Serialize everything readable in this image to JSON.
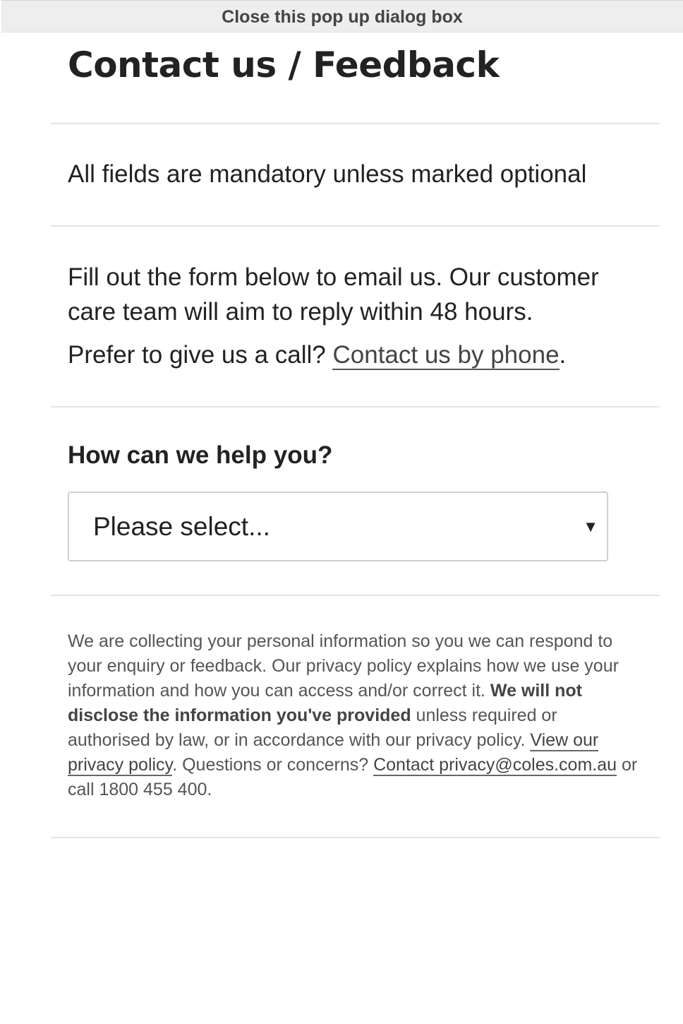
{
  "dialog": {
    "close_label": "Close this pop up dialog box",
    "title": "Contact us / Feedback"
  },
  "form": {
    "mandatory_note": "All fields are mandatory unless marked optional",
    "intro": "Fill out the form below to email us. Our customer care team will aim to reply within 48 hours.",
    "phone_prompt": "Prefer to give us a call?",
    "phone_link": "Contact us by phone",
    "phone_suffix": ".",
    "help_heading": "How can we help you?",
    "help_select": {
      "selected": "Please select...",
      "arrow_icon": "caret-down-icon"
    }
  },
  "privacy": {
    "text_1": "We are collecting your personal information so you we can respond to your enquiry or feedback. Our privacy policy explains how we use your information and how you can access and/or correct it. ",
    "bold": "We will not disclose the information you've provided",
    "text_2": " unless required or authorised by law, or in accordance with our privacy policy. ",
    "policy_link": "View our privacy policy",
    "text_3": ". Questions or concerns? ",
    "email_link": "Contact privacy@coles.com.au",
    "text_4": " or call 1800 455 400."
  }
}
